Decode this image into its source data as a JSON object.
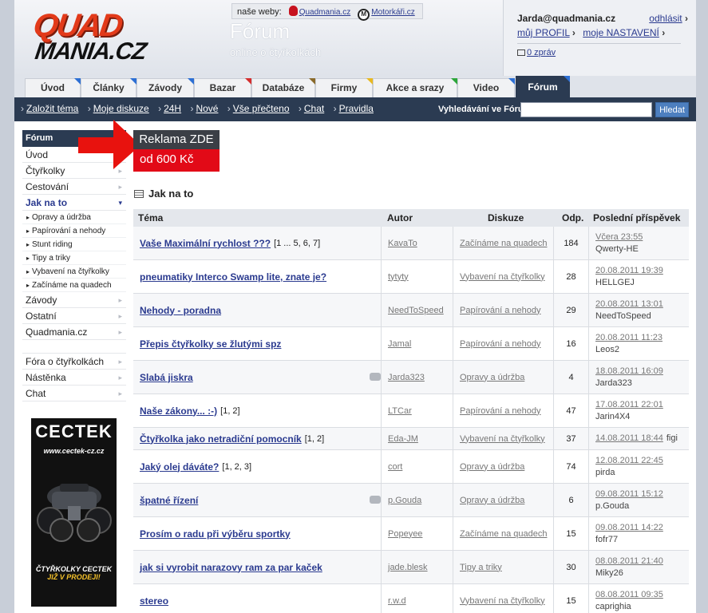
{
  "header": {
    "logo_line1": "QUAD",
    "logo_line2": "MANIA.CZ",
    "our_sites_label": "naše weby:",
    "site1": "Quadmania.cz",
    "site2": "Motorkáři.cz",
    "title": "Fórum",
    "subtitle": "online o čtyřkolkách"
  },
  "user": {
    "email": "Jarda@quadmania.cz",
    "logout": "odhlásit",
    "profile": "můj PROFIL",
    "settings": "moje NASTAVENÍ",
    "messages": "0 zpráv"
  },
  "tabs": [
    {
      "label": "Úvod",
      "color": "#2d6fd4"
    },
    {
      "label": "Články",
      "color": "#2d6fd4"
    },
    {
      "label": "Závody",
      "color": "#2d6fd4"
    },
    {
      "label": "Bazar",
      "color": "#d42d2d"
    },
    {
      "label": "Databáze",
      "color": "#8a6a2a"
    },
    {
      "label": "Firmy",
      "color": "#e8b820"
    },
    {
      "label": "Akce a srazy",
      "color": "#2da63a"
    },
    {
      "label": "Video",
      "color": "#2d6fd4"
    },
    {
      "label": "Fórum",
      "color": "#2d6fd4"
    }
  ],
  "subnav": {
    "items": [
      "Založit téma",
      "Moje diskuze",
      "24H",
      "Nové",
      "Vše přečteno",
      "Chat",
      "Pravidla"
    ],
    "search_label": "Vyhledávání ve Fóru:",
    "search_button": "Hledat"
  },
  "sidebar": {
    "head": "Fórum",
    "items1": [
      "Úvod",
      "Čtyřkolky",
      "Cestování"
    ],
    "open": "Jak na to",
    "sub": [
      "Opravy a údržba",
      "Papírování a nehody",
      "Stunt riding",
      "Tipy a triky",
      "Vybavení na čtyřkolky",
      "Začínáme na quadech"
    ],
    "items2": [
      "Závody",
      "Ostatní",
      "Quadmania.cz"
    ],
    "items3": [
      "Fóra o čtyřkolkách",
      "Nástěnka",
      "Chat"
    ]
  },
  "ad_side": {
    "brand": "CECTEK",
    "url": "www.cectek-cz.cz",
    "line1": "ČTYŘKOLKY CECTEK",
    "line2": "JIŽ V PRODEJI!"
  },
  "reklama": {
    "line1": "Reklama ZDE",
    "line2": "od 600 Kč"
  },
  "section_title": "Jak na to",
  "table": {
    "headers": {
      "topic": "Téma",
      "author": "Autor",
      "discussion": "Diskuze",
      "replies": "Odp.",
      "last": "Poslední příspěvek"
    },
    "rows": [
      {
        "topic": "Vaše Maximální rychlost ???",
        "pages": "[1 ... 5, 6, 7]",
        "author": "KavaTo",
        "disc": "Začínáme na quadech",
        "odp": "184",
        "date": "Včera 23:55",
        "who": "Qwerty-HE",
        "attach": false
      },
      {
        "topic": "pneumatiky Interco Swamp lite, znate je?",
        "pages": "",
        "author": "tytyty",
        "disc": "Vybavení na čtyřkolky",
        "odp": "28",
        "date": "20.08.2011 19:39",
        "who": "HELLGEJ",
        "attach": false
      },
      {
        "topic": "Nehody - poradna",
        "pages": "",
        "author": "NeedToSpeed",
        "disc": "Papírování a nehody",
        "odp": "29",
        "date": "20.08.2011 13:01",
        "who": "NeedToSpeed",
        "attach": false
      },
      {
        "topic": "Přepis čtyřkolky se žlutými spz",
        "pages": "",
        "author": "Jamal",
        "disc": "Papírování a nehody",
        "odp": "16",
        "date": "20.08.2011 11:23",
        "who": "Leos2",
        "attach": false
      },
      {
        "topic": "Slabá jiskra",
        "pages": "",
        "author": "Jarda323",
        "disc": "Opravy a údržba",
        "odp": "4",
        "date": "18.08.2011 16:09",
        "who": "Jarda323",
        "attach": true
      },
      {
        "topic": "Naše zákony... :-)",
        "pages": "[1, 2]",
        "author": "LTCar",
        "disc": "Papírování a nehody",
        "odp": "47",
        "date": "17.08.2011 22:01",
        "who": "Jarin4X4",
        "attach": false
      },
      {
        "topic": "Čtyřkolka jako netradiční pomocník",
        "pages": "[1, 2]",
        "author": "Eda-JM",
        "disc": "Vybavení na čtyřkolky",
        "odp": "37",
        "date": "14.08.2011 18:44",
        "who": "figi",
        "attach": false,
        "short": true
      },
      {
        "topic": "Jaký olej dáváte?",
        "pages": "[1, 2, 3]",
        "author": "cort",
        "disc": "Opravy a údržba",
        "odp": "74",
        "date": "12.08.2011 22:45",
        "who": "pirda",
        "attach": false
      },
      {
        "topic": "špatné řízení",
        "pages": "",
        "author": "p.Gouda",
        "disc": "Opravy a údržba",
        "odp": "6",
        "date": "09.08.2011 15:12",
        "who": "p.Gouda",
        "attach": true
      },
      {
        "topic": "Prosím o radu při výběru sportky",
        "pages": "",
        "author": "Popeyee",
        "disc": "Začínáme na quadech",
        "odp": "15",
        "date": "09.08.2011 14:22",
        "who": "fofr77",
        "attach": false
      },
      {
        "topic": "jak si vyrobit narazovy ram za par kaček",
        "pages": "",
        "author": "jade.blesk",
        "disc": "Tipy a triky",
        "odp": "30",
        "date": "08.08.2011 21:40",
        "who": "Miky26",
        "attach": false
      },
      {
        "topic": "stereo",
        "pages": "",
        "author": "r.w.d",
        "disc": "Vybavení na čtyřkolky",
        "odp": "15",
        "date": "08.08.2011 09:35",
        "who": "caprighia",
        "attach": false
      }
    ]
  }
}
